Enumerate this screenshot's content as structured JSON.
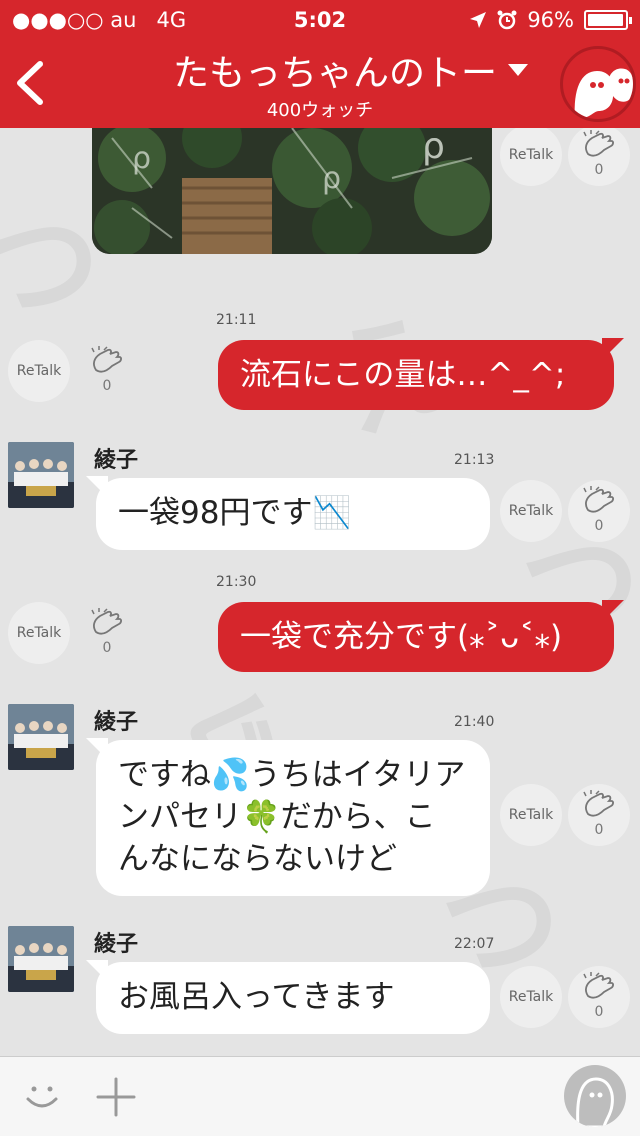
{
  "status_bar": {
    "carrier": "●●●○○ au",
    "network": "4G",
    "time": "5:02",
    "battery": "96%",
    "battery_level": 0.96
  },
  "header": {
    "title": "たもっちゃんのトー",
    "watch_count": "400ウォッチ",
    "accent_color": "#d6262c"
  },
  "retalk_label": "ReTalk",
  "messages": [
    {
      "type": "photo",
      "clap_count": "0"
    },
    {
      "type": "mine",
      "time": "21:11",
      "text": "流石にこの量は…^_^;",
      "clap_count": "0"
    },
    {
      "type": "theirs",
      "name": "綾子",
      "time": "21:13",
      "text": "一袋98円です📉",
      "clap_count": "0"
    },
    {
      "type": "mine",
      "time": "21:30",
      "text": "一袋で充分です(⁎˃ᴗ˂⁎)",
      "clap_count": "0"
    },
    {
      "type": "theirs",
      "name": "綾子",
      "time": "21:40",
      "lines": [
        "ですね💦うちはイタリア",
        "ンパセリ🍀だから、こ",
        "んなにならないけど"
      ],
      "clap_count": "0"
    },
    {
      "type": "theirs",
      "name": "綾子",
      "time": "22:07",
      "text": "お風呂入ってきます",
      "clap_count": "0"
    }
  ],
  "input_bar": {
    "icons": [
      "smiley-icon",
      "plus-icon",
      "ghost-avatar-icon"
    ]
  }
}
